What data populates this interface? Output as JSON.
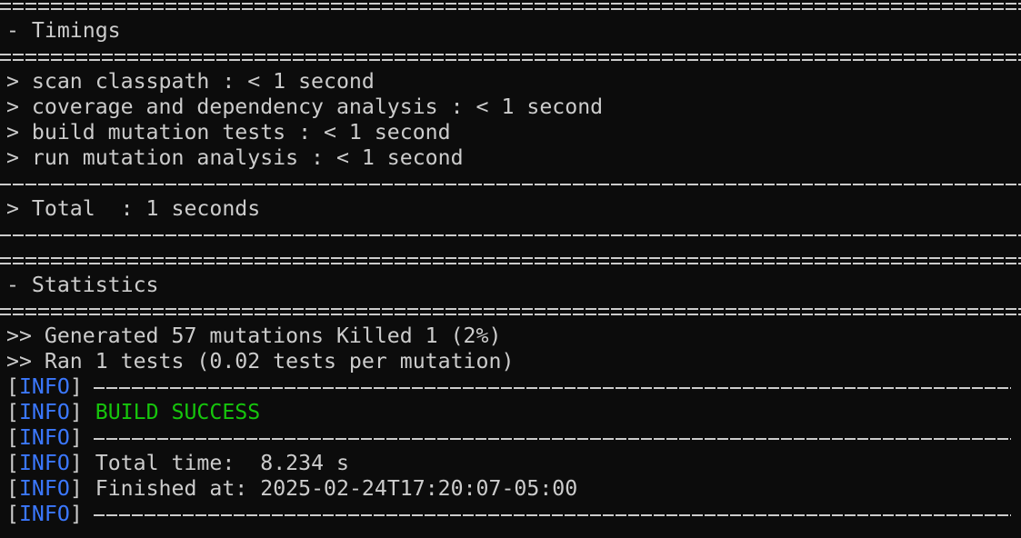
{
  "timings": {
    "header": "- Timings",
    "items": [
      "> scan classpath : < 1 second",
      "> coverage and dependency analysis : < 1 second",
      "> build mutation tests : < 1 second",
      "> run mutation analysis : < 1 second"
    ],
    "total": "> Total  : 1 seconds"
  },
  "statistics": {
    "header": "- Statistics",
    "items": [
      ">> Generated 57 mutations Killed 1 (2%)",
      ">> Ran 1 tests (0.02 tests per mutation)"
    ]
  },
  "info": {
    "open_bracket": "[",
    "level": "INFO",
    "close_bracket": "]",
    "build_status": "BUILD SUCCESS",
    "total_time": "Total time:  8.234 s",
    "finished_at": "Finished at: 2025-02-24T17:20:07-05:00"
  },
  "colors": {
    "background": "#0c0c0c",
    "foreground": "#cccccc",
    "info_level": "#3b78ff",
    "success": "#16c60c"
  }
}
